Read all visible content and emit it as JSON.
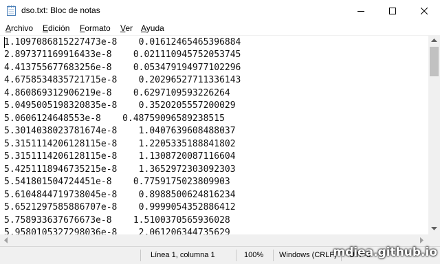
{
  "window": {
    "title": "dso.txt: Bloc de notas",
    "minimize_glyph": "—",
    "maximize_glyph": "☐",
    "close_glyph": "✕"
  },
  "menu": [
    {
      "underline": "A",
      "rest": "rchivo"
    },
    {
      "underline": "E",
      "rest": "dición"
    },
    {
      "underline": "F",
      "rest": "ormato"
    },
    {
      "underline": "V",
      "rest": "er"
    },
    {
      "underline": "A",
      "rest": "yuda"
    }
  ],
  "lines": [
    "1.1097086815227473e-8    0.01612465465396884",
    "2.897371169916433e-8    0.021110945752053745",
    "4.413755677683256e-8    0.053479194977102296",
    "4.6758534835721715e-8    0.20296527711336143",
    "4.860869312906219e-8    0.6297109593226264",
    "5.0495005198320835e-8    0.3520205557200029",
    "5.0606124648553e-8    0.48759096589238515",
    "5.3014038023781674e-8    1.0407639608488037",
    "5.3151114206128115e-8    1.2205335188841802",
    "5.3151114206128115e-8    1.1308720087116604",
    "5.4251118946735215e-8    1.3652972303092303",
    "5.541801504724451e-8    0.7759175023809903",
    "5.6104844719738045e-8    0.8988500624816234",
    "5.6521297585886707e-8    0.9999054352886412",
    "5.758933637676673e-8    1.5100370565936028",
    "5.9580105327298036e-8    2.061206344735629"
  ],
  "status": {
    "position": "Línea 1, columna 1",
    "zoom": "100%",
    "line_ending": "Windows (CRLF)",
    "encoding": "UTF-8"
  },
  "watermark": "mdiea.github.io"
}
